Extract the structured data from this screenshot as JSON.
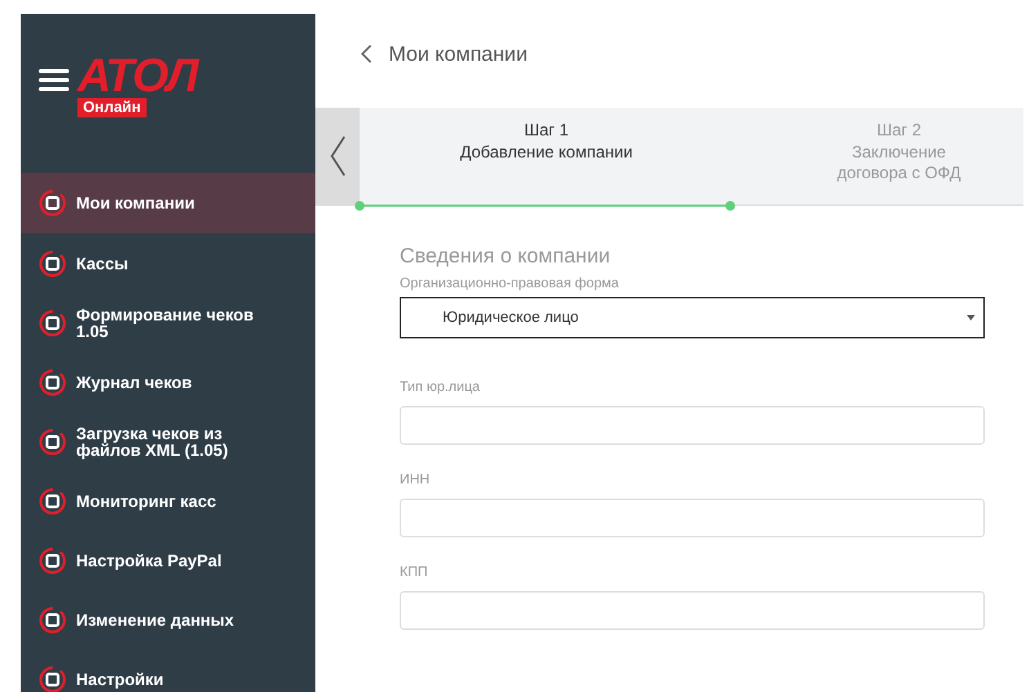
{
  "sidebar": {
    "logo": {
      "brand": "АТОЛ",
      "badge": "Онлайн"
    },
    "items": [
      {
        "label": "Мои компании",
        "selected": true
      },
      {
        "label": "Кассы",
        "selected": false
      },
      {
        "label": "Формирование чеков 1.05",
        "selected": false
      },
      {
        "label": "Журнал чеков",
        "selected": false
      },
      {
        "label": "Загрузка чеков из файлов XML (1.05)",
        "selected": false
      },
      {
        "label": "Мониторинг касс",
        "selected": false
      },
      {
        "label": "Настройка PayPal",
        "selected": false
      },
      {
        "label": "Изменение данных",
        "selected": false
      },
      {
        "label": "Настройки",
        "selected": false
      }
    ]
  },
  "header": {
    "title": "Мои компании"
  },
  "steps": [
    {
      "number": "Шаг 1",
      "label": "Добавление компании",
      "selected": true
    },
    {
      "number": "Шаг 2",
      "label": "Заключение договора с ОФД",
      "selected": false
    }
  ],
  "form": {
    "section_title": "Сведения о компании",
    "fields": [
      {
        "kind": "select",
        "label": "Организационно-правовая форма",
        "value": "Юридическое лицо"
      },
      {
        "kind": "text",
        "label": "Тип юр.лица"
      },
      {
        "kind": "text",
        "label": "ИНН"
      },
      {
        "kind": "text",
        "label": "КПП"
      }
    ]
  }
}
